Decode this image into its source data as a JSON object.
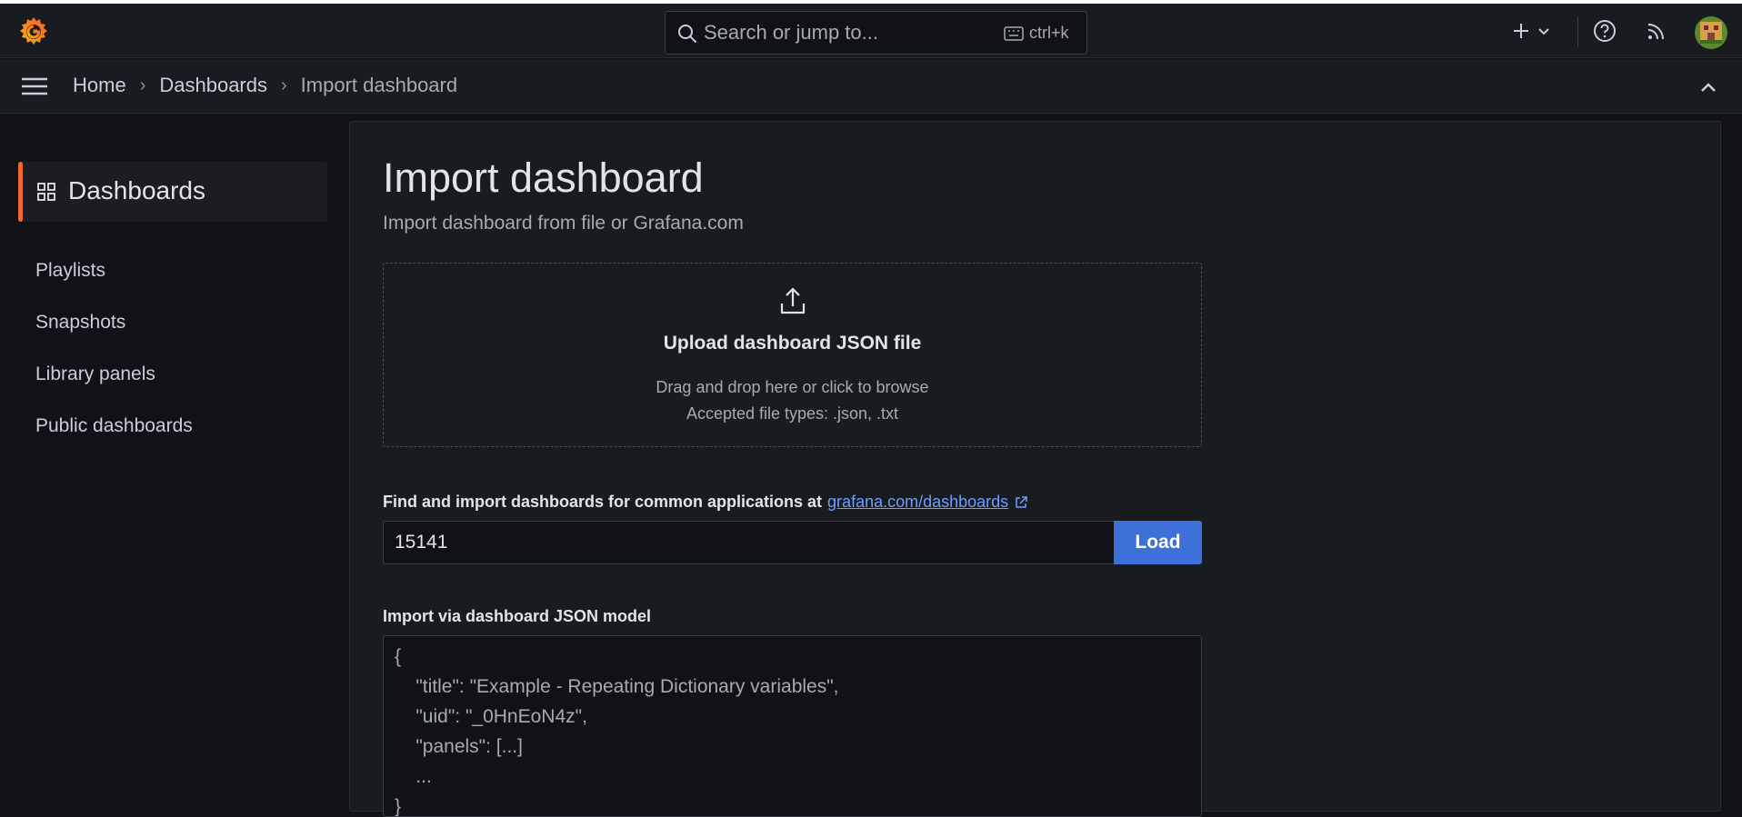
{
  "topbar": {
    "search": {
      "placeholder": "Search or jump to...",
      "shortcut": "ctrl+k"
    },
    "icons": [
      "grafana-logo",
      "search-icon",
      "keyboard-icon",
      "plus-icon",
      "chevron-down-icon",
      "help-icon",
      "rss-icon",
      "avatar"
    ]
  },
  "breadcrumb": {
    "items": [
      "Home",
      "Dashboards",
      "Import dashboard"
    ],
    "separator": "›"
  },
  "sidebar": {
    "active": {
      "label": "Dashboards",
      "icon": "apps-grid-icon"
    },
    "items": [
      "Playlists",
      "Snapshots",
      "Library panels",
      "Public dashboards"
    ]
  },
  "main": {
    "title": "Import dashboard",
    "subtitle": "Import dashboard from file or Grafana.com",
    "upload": {
      "title": "Upload dashboard JSON file",
      "hint1": "Drag and drop here or click to browse",
      "hint2": "Accepted file types: .json, .txt"
    },
    "find": {
      "label": "Find and import dashboards for common applications at",
      "link": "grafana.com/dashboards",
      "value": "15141",
      "load_label": "Load"
    },
    "json_model": {
      "label": "Import via dashboard JSON model",
      "lines": [
        "{",
        "    \"title\": \"Example - Repeating Dictionary variables\",",
        "    \"uid\": \"_0HnEoN4z\",",
        "    \"panels\": [...]",
        "    ...",
        "}"
      ]
    }
  },
  "colors": {
    "accent": "#f0692b",
    "primary": "#3d71d9",
    "link": "#6e9fff",
    "background": "#111217",
    "panel": "#181b1f"
  }
}
